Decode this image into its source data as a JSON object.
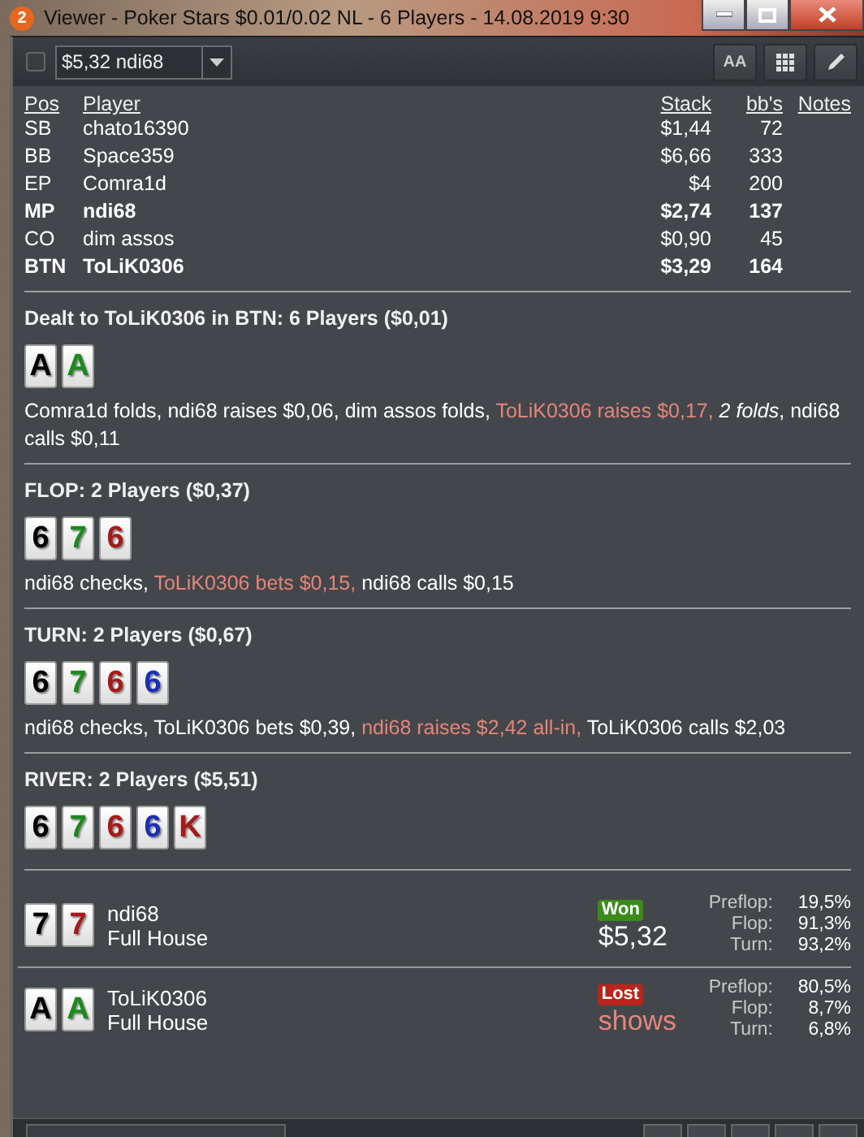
{
  "window": {
    "app_badge": "2",
    "title": "Viewer - Poker Stars $0.01/0.02 NL - 6 Players - 14.08.2019 9:30"
  },
  "toolbar": {
    "checkbox_checked": false,
    "hand_select": "$5,32 ndi68",
    "font_button": "AA"
  },
  "players": {
    "columns": [
      "Pos",
      "Player",
      "Stack",
      "bb's",
      "Notes"
    ],
    "rows": [
      {
        "pos": "SB",
        "name": "chato16390",
        "stack": "$1,44",
        "bbs": "72",
        "hero": false
      },
      {
        "pos": "BB",
        "name": "Space359",
        "stack": "$6,66",
        "bbs": "333",
        "hero": false
      },
      {
        "pos": "EP",
        "name": "Comra1d",
        "stack": "$4",
        "bbs": "200",
        "hero": false
      },
      {
        "pos": "MP",
        "name": "ndi68",
        "stack": "$2,74",
        "bbs": "137",
        "hero": true
      },
      {
        "pos": "CO",
        "name": "dim assos",
        "stack": "$0,90",
        "bbs": "45",
        "hero": false
      },
      {
        "pos": "BTN",
        "name": "ToLiK0306",
        "stack": "$3,29",
        "bbs": "164",
        "hero": true
      }
    ]
  },
  "streets": [
    {
      "title": "Dealt to ToLiK0306 in BTN: 6 Players ($0,01)",
      "cards": [
        {
          "rank": "A",
          "color": "#000000"
        },
        {
          "rank": "A",
          "color": "#1a8a1a"
        }
      ],
      "actions": [
        {
          "text": "Comra1d folds, ndi68 raises $0,06, dim assos folds, ",
          "kind": "plain"
        },
        {
          "text": "ToLiK0306 raises $0,17, ",
          "kind": "hero"
        },
        {
          "text": "2 folds",
          "kind": "summary"
        },
        {
          "text": ", ndi68 calls $0,11",
          "kind": "plain"
        }
      ]
    },
    {
      "title": "FLOP: 2 Players ($0,37)",
      "cards": [
        {
          "rank": "6",
          "color": "#000000"
        },
        {
          "rank": "7",
          "color": "#1a8a1a"
        },
        {
          "rank": "6",
          "color": "#a81a1a"
        }
      ],
      "actions": [
        {
          "text": "ndi68 checks, ",
          "kind": "plain"
        },
        {
          "text": "ToLiK0306 bets $0,15, ",
          "kind": "hero"
        },
        {
          "text": "ndi68 calls $0,15",
          "kind": "plain"
        }
      ]
    },
    {
      "title": "TURN: 2 Players ($0,67)",
      "cards": [
        {
          "rank": "6",
          "color": "#000000"
        },
        {
          "rank": "7",
          "color": "#1a8a1a"
        },
        {
          "rank": "6",
          "color": "#a81a1a"
        },
        {
          "rank": "6",
          "color": "#1a2fb8"
        }
      ],
      "actions": [
        {
          "text": "ndi68 checks, ToLiK0306 bets $0,39, ",
          "kind": "plain"
        },
        {
          "text": "ndi68 raises $2,42 all-in, ",
          "kind": "hero"
        },
        {
          "text": "ToLiK0306 calls $2,03",
          "kind": "plain"
        }
      ]
    },
    {
      "title": "RIVER: 2 Players ($5,51)",
      "cards": [
        {
          "rank": "6",
          "color": "#000000"
        },
        {
          "rank": "7",
          "color": "#1a8a1a"
        },
        {
          "rank": "6",
          "color": "#a81a1a"
        },
        {
          "rank": "6",
          "color": "#1a2fb8"
        },
        {
          "rank": "K",
          "color": "#a81a1a"
        }
      ]
    }
  ],
  "results": [
    {
      "cards": [
        {
          "rank": "7",
          "color": "#000000"
        },
        {
          "rank": "7",
          "color": "#a81a1a"
        }
      ],
      "name": "ndi68",
      "hand": "Full House",
      "kind": "won",
      "badge": "Won",
      "amount": "$5,32",
      "equity": [
        {
          "label": "Preflop:",
          "value": "19,5%"
        },
        {
          "label": "Flop:",
          "value": "91,3%"
        },
        {
          "label": "Turn:",
          "value": "93,2%"
        }
      ]
    },
    {
      "cards": [
        {
          "rank": "A",
          "color": "#000000"
        },
        {
          "rank": "A",
          "color": "#1a8a1a"
        }
      ],
      "name": "ToLiK0306",
      "hand": "Full House",
      "kind": "lost",
      "badge": "Lost",
      "amount": "shows",
      "equity": [
        {
          "label": "Preflop:",
          "value": "80,5%"
        },
        {
          "label": "Flop:",
          "value": "8,7%"
        },
        {
          "label": "Turn:",
          "value": "6,8%"
        }
      ]
    }
  ]
}
